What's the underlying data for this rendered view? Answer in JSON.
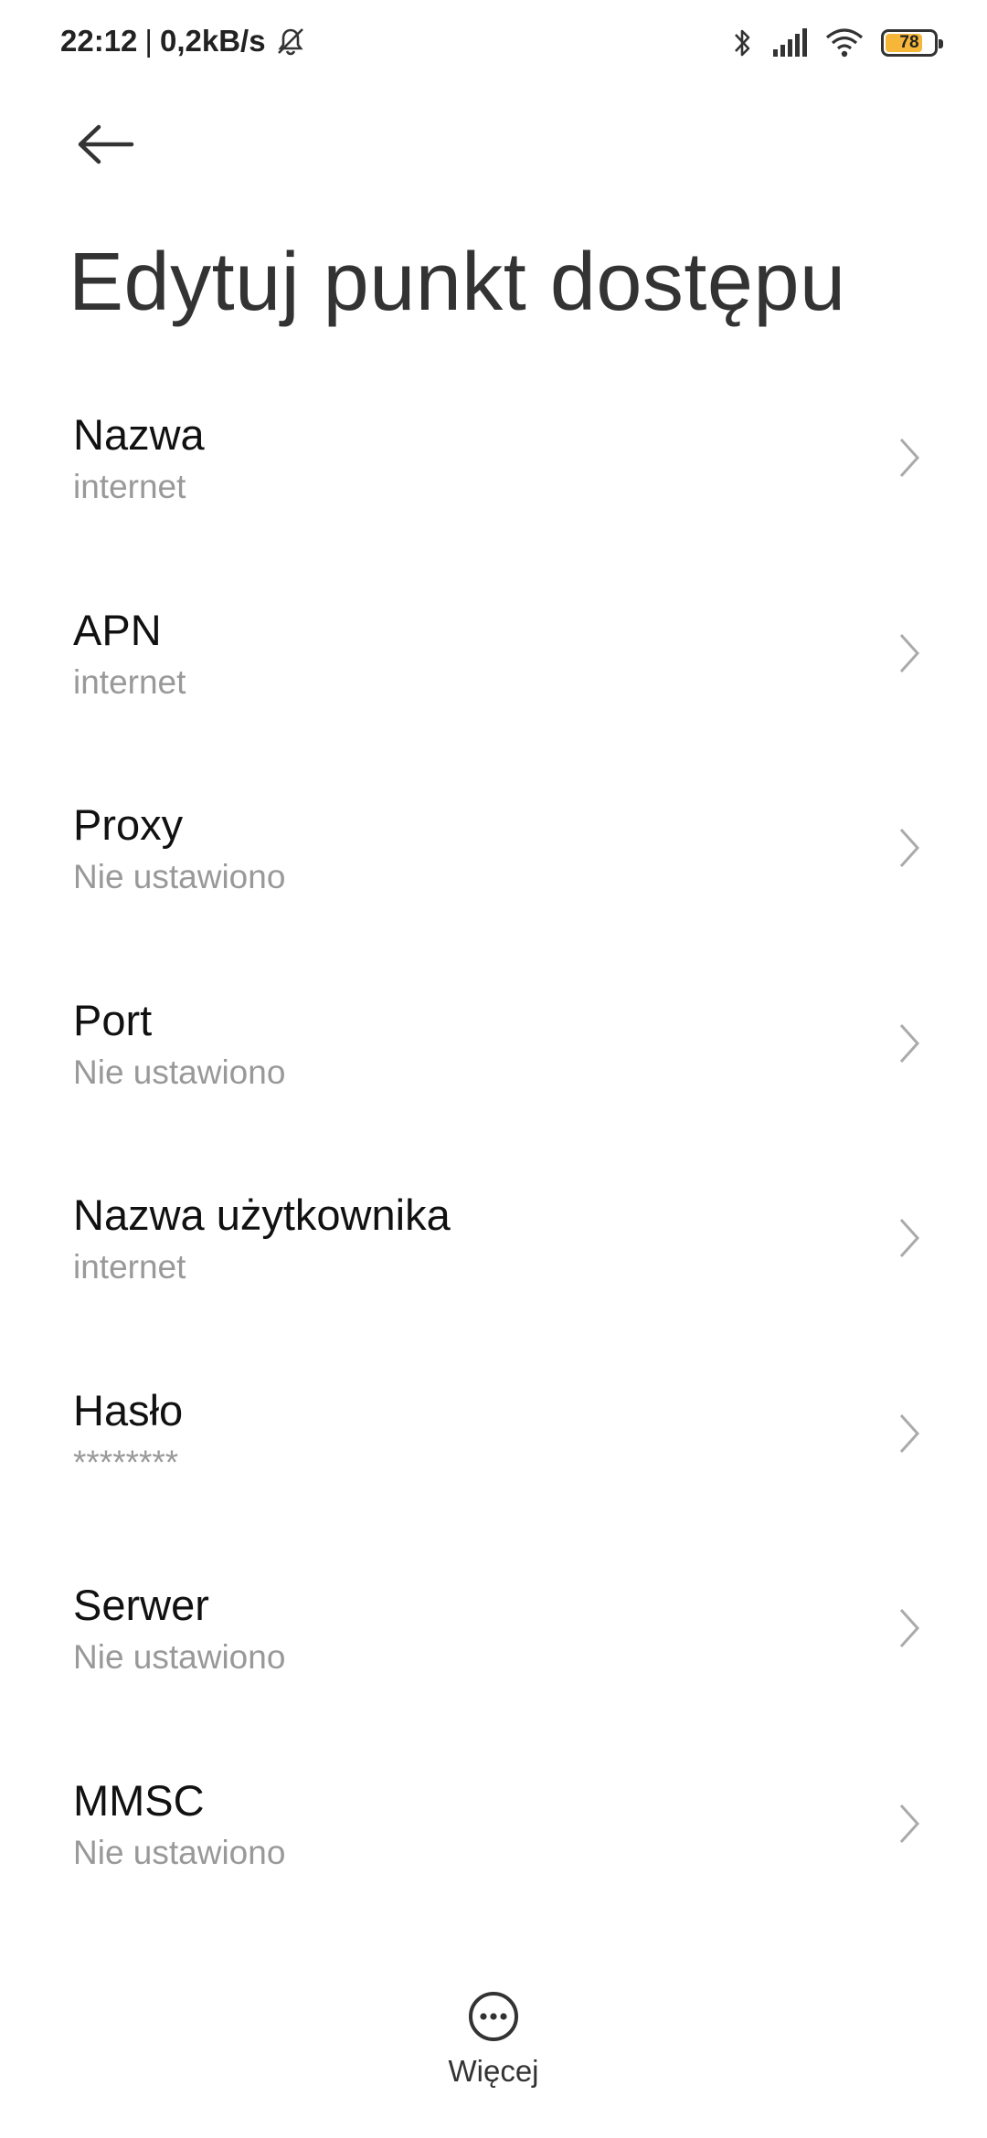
{
  "status_bar": {
    "time": "22:12",
    "separator": "|",
    "net_speed": "0,2kB/s",
    "battery_level": "78",
    "battery_fraction": 0.78,
    "icons": [
      "mute-notifications-icon",
      "bluetooth-icon",
      "signal-icon",
      "wifi-icon",
      "battery-icon"
    ],
    "battery_fill_color": "#f5b63a"
  },
  "header": {
    "back_icon": "back-arrow-icon",
    "title": "Edytuj punkt dostępu"
  },
  "settings": [
    {
      "label": "Nazwa",
      "value": "internet"
    },
    {
      "label": "APN",
      "value": "internet"
    },
    {
      "label": "Proxy",
      "value": "Nie ustawiono"
    },
    {
      "label": "Port",
      "value": "Nie ustawiono"
    },
    {
      "label": "Nazwa użytkownika",
      "value": "internet"
    },
    {
      "label": "Hasło",
      "value": "********"
    },
    {
      "label": "Serwer",
      "value": "Nie ustawiono"
    },
    {
      "label": "MMSC",
      "value": "Nie ustawiono"
    }
  ],
  "footer": {
    "more_icon": "more-dots-icon",
    "more_label": "Więcej"
  }
}
